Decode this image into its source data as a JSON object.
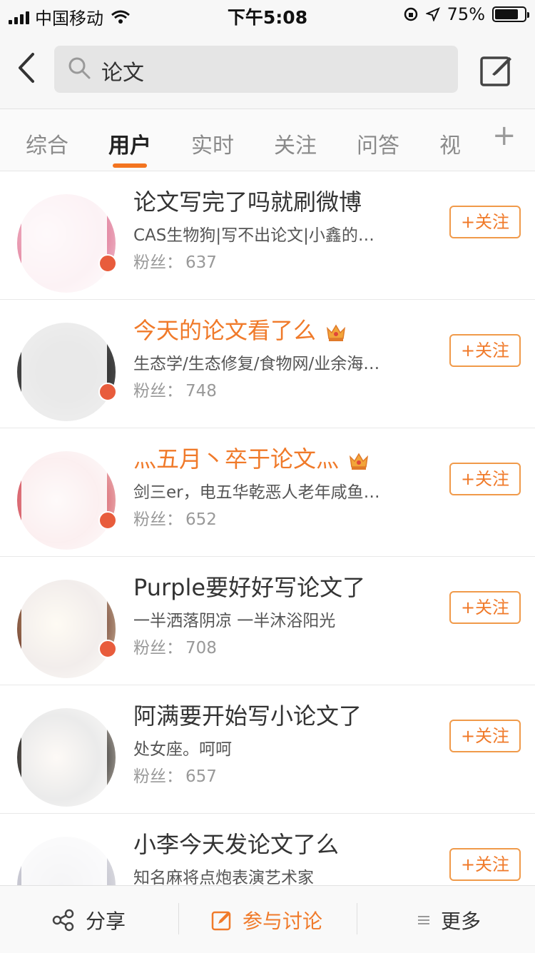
{
  "status_bar": {
    "carrier": "中国移动",
    "time": "下午5:08",
    "battery": "75%",
    "battery_level": 0.75
  },
  "search": {
    "query": "论文"
  },
  "tabs": [
    {
      "label": "综合",
      "active": false
    },
    {
      "label": "用户",
      "active": true
    },
    {
      "label": "实时",
      "active": false
    },
    {
      "label": "关注",
      "active": false
    },
    {
      "label": "问答",
      "active": false
    },
    {
      "label": "视",
      "active": false
    }
  ],
  "tab_add": "+",
  "results": [
    {
      "name": "论文写完了吗就刷微博",
      "desc": "CAS生物狗|写不出论文|小鑫的…",
      "fans_label": "粉丝：",
      "fans": "637",
      "follow": "+关注",
      "vip": false
    },
    {
      "name": "今天的论文看了么",
      "desc": "生态学/生态修复/食物网/业余海…",
      "fans_label": "粉丝：",
      "fans": "748",
      "follow": "+关注",
      "vip": true
    },
    {
      "name": "灬五月丶卒于论文灬",
      "desc": "剑三er，电五华乾恶人老年咸鱼…",
      "fans_label": "粉丝：",
      "fans": "652",
      "follow": "+关注",
      "vip": true
    },
    {
      "name": "Purple要好好写论文了",
      "desc": "一半洒落阴凉 一半沐浴阳光",
      "fans_label": "粉丝：",
      "fans": "708",
      "follow": "+关注",
      "vip": false
    },
    {
      "name": "阿满要开始写小论文了",
      "desc": "处女座。呵呵",
      "fans_label": "粉丝：",
      "fans": "657",
      "follow": "+关注",
      "vip": false
    },
    {
      "name": "小李今天发论文了么",
      "desc": "知名麻将点炮表演艺术家",
      "fans_label": "",
      "fans": "",
      "follow": "+关注",
      "vip": false
    }
  ],
  "bottom_bar": {
    "share": "分享",
    "discuss": "参与讨论",
    "more": "更多"
  },
  "colors": {
    "accent": "#f07a2a",
    "vip_name": "#f07a2a"
  }
}
